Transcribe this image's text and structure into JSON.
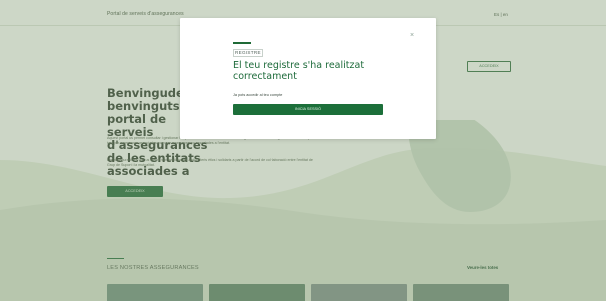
{
  "header": {
    "portal_title": "Portal de serveis d'assegurances",
    "language": "Es | en",
    "access_button": "ACCEDEIX"
  },
  "hero": {
    "title": "Benvingudes i benvinguts al portal de serveis d'assegurances de les entitats associades a",
    "paragraph1": "Aquest portal us permet consultar i gestionar les pòlisses i serveis de les entitats asseguradores. Els continguts es mostren al portal tant per a persones associades com per a persones no associades a l'entitat.",
    "paragraph2": "Les asseguradores que us oferim són gestionades amb criteris ètics i solidaris a partir de l'acord de col·laboració entre l'entitat de Grup de Suport i la mutualitat.",
    "button": "ACCEDEIX"
  },
  "section": {
    "title": "LES NOSTRES ASSEGURANCES",
    "link": "Veure-les totes"
  },
  "modal": {
    "kicker": "REGISTRE",
    "title": "El teu registre s'ha realitzat correctament",
    "description": "Ja pots accedir al teu compte",
    "button": "INICIA SESSIÓ",
    "close": "×"
  },
  "colors": {
    "brand_green": "#1f6a36",
    "title_green": "#1e6b3b",
    "overlay": "rgba(140,160,130,0.38)"
  }
}
